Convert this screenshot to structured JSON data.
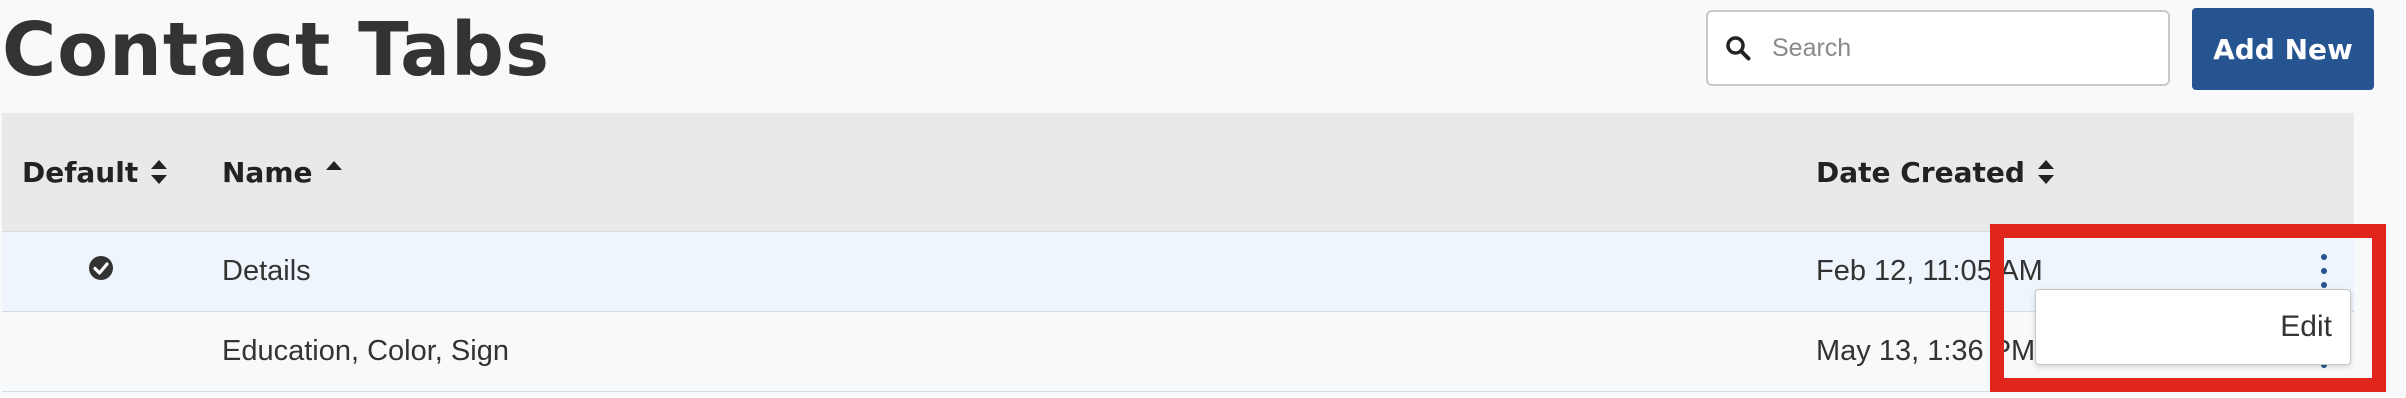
{
  "page": {
    "title": "Contact Tabs"
  },
  "search": {
    "placeholder": "Search",
    "value": ""
  },
  "actions": {
    "add_label": "Add New"
  },
  "table": {
    "columns": [
      {
        "label": "Default",
        "sort": "both"
      },
      {
        "label": "Name",
        "sort": "ascending"
      },
      {
        "label": "Date Created",
        "sort": "both"
      }
    ],
    "rows": [
      {
        "default": true,
        "name": "Details",
        "date_created": "Feb 12, 11:05 AM"
      },
      {
        "default": false,
        "name": "Education, Color, Sign",
        "date_created": "May 13, 1:36 PM"
      }
    ]
  },
  "row_menu": {
    "items": [
      {
        "label": "Edit"
      }
    ]
  },
  "colors": {
    "accent": "#255490",
    "highlight": "#e0261b",
    "header_bg": "#e9e9e9",
    "selected_row_bg": "#eef5fc"
  }
}
